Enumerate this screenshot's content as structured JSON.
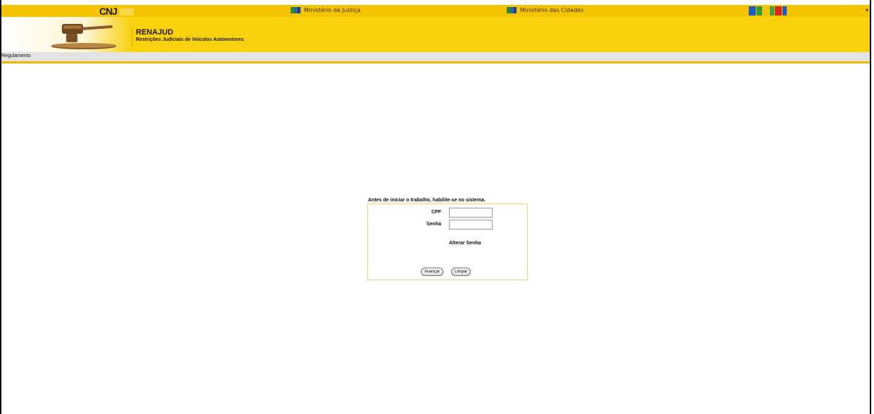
{
  "topbar": {
    "brand": "CNJ",
    "ministries": [
      "Ministério da Justiça",
      "Ministério das Cidades"
    ],
    "brasil_flag_colors": [
      "#1e5bbf",
      "#2f9a3a",
      "#f3c300",
      "#3aa04a",
      "#d8281e",
      "#1e5bbf"
    ]
  },
  "header": {
    "title": "RENAJUD",
    "subtitle": "Restrições Judiciais de Veículos Automotores"
  },
  "menu": {
    "items": [
      "Regulamento"
    ]
  },
  "login": {
    "heading": "Antes de iniciar o trabalho, habilite-se no sistema.",
    "cpf_label": "CPF",
    "cpf_value": "",
    "senha_label": "Senha",
    "senha_value": "",
    "change_password": "Alterar Senha",
    "submit_label": "Avançar",
    "clear_label": "Limpar"
  },
  "colors": {
    "accent_yellow": "#f5c400",
    "menu_gray": "#e3e3e3"
  }
}
